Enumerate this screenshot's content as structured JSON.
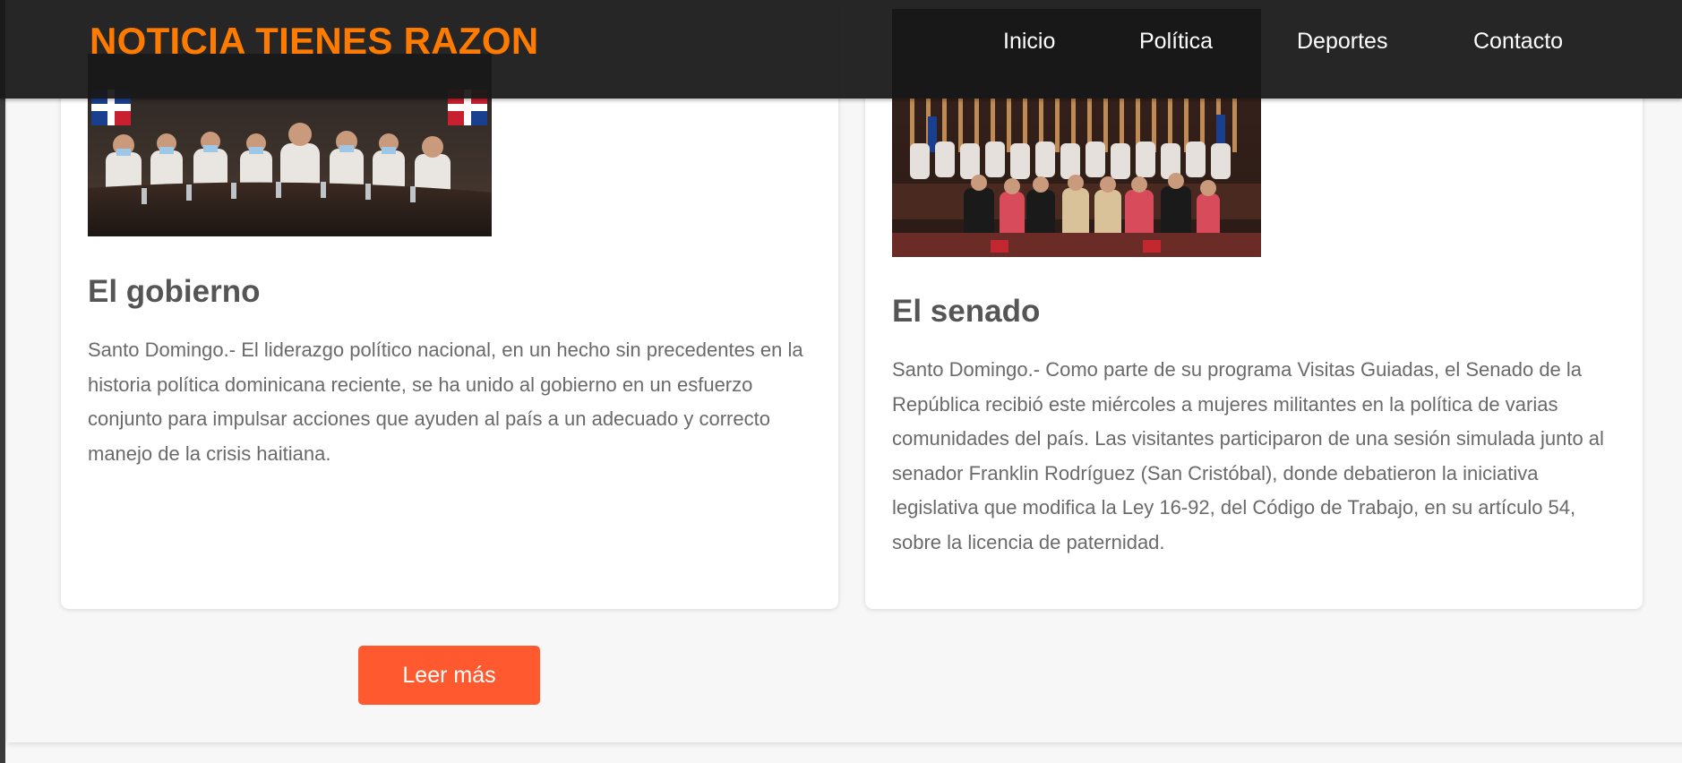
{
  "navbar": {
    "brand": "NOTICIA TIENES RAZON",
    "links": [
      "Inicio",
      "Política",
      "Deportes",
      "Contacto"
    ]
  },
  "articles": [
    {
      "title": "El gobierno",
      "body": "Santo Domingo.- El liderazgo político nacional, en un hecho sin precedentes en la historia política dominicana reciente, se ha unido al gobierno en un esfuerzo conjunto para impulsar acciones que ayuden al país a un adecuado y correcto manejo de la crisis haitiana.",
      "image": "government-meeting-photo"
    },
    {
      "title": "El senado",
      "body": "Santo Domingo.- Como parte de su programa Visitas Guiadas, el Senado de la República recibió este miércoles a mujeres militantes en la política de varias comunidades del país. Las visitantes participaron de una sesión simulada junto al senador Franklin Rodríguez (San Cristóbal), donde debatieron la iniciativa legislativa que modifica la Ley 16-92, del Código de Trabajo, en su artículo 54, sobre la licencia de paternidad.",
      "image": "senate-group-photo"
    }
  ],
  "read_more_label": "Leer más",
  "colors": {
    "brand": "#ff7b00",
    "navbar_bg": "#181818",
    "button_bg": "#ff5a2f",
    "title_text": "#555555",
    "body_text": "#6a6a6a"
  }
}
